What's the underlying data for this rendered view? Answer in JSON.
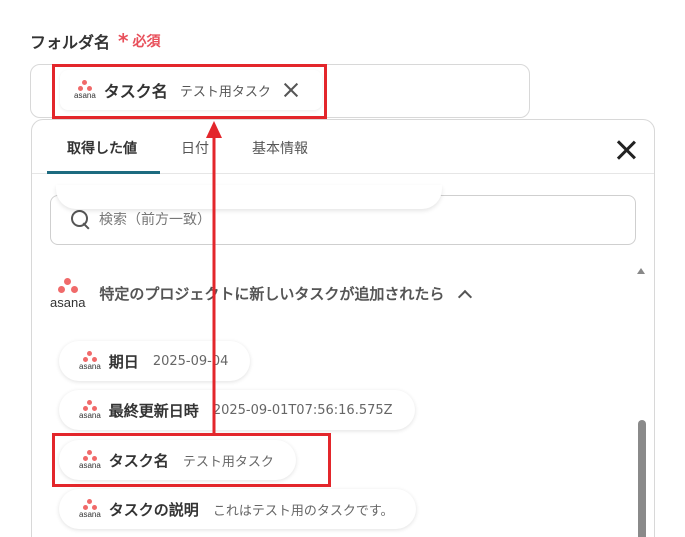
{
  "field": {
    "label": "フォルダ名",
    "required_mark": "*",
    "required_text": "必須"
  },
  "selected_chip": {
    "icon_text": "asana",
    "name": "タスク名",
    "value": "テスト用タスク"
  },
  "tabs": [
    {
      "label": "取得した値",
      "active": true
    },
    {
      "label": "日付",
      "active": false
    },
    {
      "label": "基本情報",
      "active": false
    }
  ],
  "search": {
    "placeholder": "検索（前方一致）"
  },
  "group": {
    "icon_text": "asana",
    "title": "特定のプロジェクトに新しいタスクが追加されたら"
  },
  "items": [
    {
      "icon_text": "asana",
      "name": "期日",
      "value": "2025-09-04"
    },
    {
      "icon_text": "asana",
      "name": "最終更新日時",
      "value": "2025-09-01T07:56:16.575Z"
    },
    {
      "icon_text": "asana",
      "name": "タスク名",
      "value": "テスト用タスク"
    },
    {
      "icon_text": "asana",
      "name": "タスクの説明",
      "value": "これはテスト用のタスクです。"
    }
  ],
  "colors": {
    "accent": "#1d6b80",
    "required": "#e8505b",
    "highlight": "#e3262b",
    "asana": "#f06a6a"
  }
}
